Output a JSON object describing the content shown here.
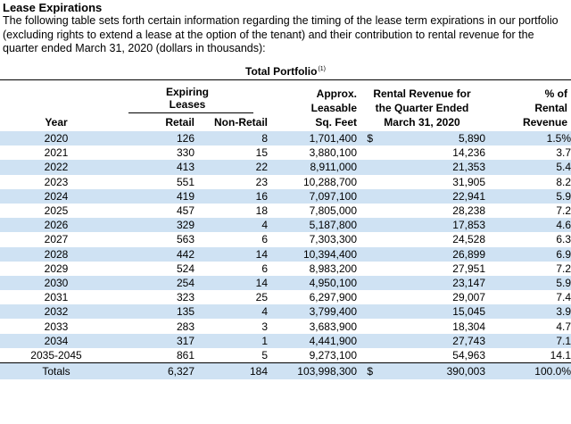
{
  "title": "Lease Expirations",
  "intro": "The following table sets forth certain information regarding the timing of the lease term expirations in our portfolio (excluding rights to extend a lease at the option of the tenant) and their contribution to rental revenue for the quarter ended March 31, 2020 (dollars in thousands):",
  "portfolio_label": "Total Portfolio",
  "portfolio_footnote": "(1)",
  "headers": {
    "expiring": "Expiring",
    "leases": "Leases",
    "year": "Year",
    "retail": "Retail",
    "non_retail": "Non-Retail",
    "approx": "Approx.",
    "leasable": "Leasable",
    "sqft": "Sq. Feet",
    "rev_line1": "Rental Revenue for",
    "rev_line2": "the Quarter Ended",
    "rev_line3": "March 31, 2020",
    "pct_line1": "% of",
    "pct_line2": "Rental",
    "pct_line3": "Revenue"
  },
  "dollar_sign": "$",
  "rows": [
    {
      "year": "2020",
      "retail": "126",
      "non_retail": "8",
      "sqft": "1,701,400",
      "revenue": "5,890",
      "pct": "1.5%",
      "dollar": "$"
    },
    {
      "year": "2021",
      "retail": "330",
      "non_retail": "15",
      "sqft": "3,880,100",
      "revenue": "14,236",
      "pct": "3.7",
      "dollar": ""
    },
    {
      "year": "2022",
      "retail": "413",
      "non_retail": "22",
      "sqft": "8,911,000",
      "revenue": "21,353",
      "pct": "5.4",
      "dollar": ""
    },
    {
      "year": "2023",
      "retail": "551",
      "non_retail": "23",
      "sqft": "10,288,700",
      "revenue": "31,905",
      "pct": "8.2",
      "dollar": ""
    },
    {
      "year": "2024",
      "retail": "419",
      "non_retail": "16",
      "sqft": "7,097,100",
      "revenue": "22,941",
      "pct": "5.9",
      "dollar": ""
    },
    {
      "year": "2025",
      "retail": "457",
      "non_retail": "18",
      "sqft": "7,805,000",
      "revenue": "28,238",
      "pct": "7.2",
      "dollar": ""
    },
    {
      "year": "2026",
      "retail": "329",
      "non_retail": "4",
      "sqft": "5,187,800",
      "revenue": "17,853",
      "pct": "4.6",
      "dollar": ""
    },
    {
      "year": "2027",
      "retail": "563",
      "non_retail": "6",
      "sqft": "7,303,300",
      "revenue": "24,528",
      "pct": "6.3",
      "dollar": ""
    },
    {
      "year": "2028",
      "retail": "442",
      "non_retail": "14",
      "sqft": "10,394,400",
      "revenue": "26,899",
      "pct": "6.9",
      "dollar": ""
    },
    {
      "year": "2029",
      "retail": "524",
      "non_retail": "6",
      "sqft": "8,983,200",
      "revenue": "27,951",
      "pct": "7.2",
      "dollar": ""
    },
    {
      "year": "2030",
      "retail": "254",
      "non_retail": "14",
      "sqft": "4,950,100",
      "revenue": "23,147",
      "pct": "5.9",
      "dollar": ""
    },
    {
      "year": "2031",
      "retail": "323",
      "non_retail": "25",
      "sqft": "6,297,900",
      "revenue": "29,007",
      "pct": "7.4",
      "dollar": ""
    },
    {
      "year": "2032",
      "retail": "135",
      "non_retail": "4",
      "sqft": "3,799,400",
      "revenue": "15,045",
      "pct": "3.9",
      "dollar": ""
    },
    {
      "year": "2033",
      "retail": "283",
      "non_retail": "3",
      "sqft": "3,683,900",
      "revenue": "18,304",
      "pct": "4.7",
      "dollar": ""
    },
    {
      "year": "2034",
      "retail": "317",
      "non_retail": "1",
      "sqft": "4,441,900",
      "revenue": "27,743",
      "pct": "7.1",
      "dollar": ""
    },
    {
      "year": "2035-2045",
      "retail": "861",
      "non_retail": "5",
      "sqft": "9,273,100",
      "revenue": "54,963",
      "pct": "14.1",
      "dollar": ""
    }
  ],
  "totals": {
    "year": "Totals",
    "retail": "6,327",
    "non_retail": "184",
    "sqft": "103,998,300",
    "revenue": "390,003",
    "pct": "100.0%",
    "dollar": "$"
  },
  "colors": {
    "row_shade": "#cfe2f3"
  }
}
